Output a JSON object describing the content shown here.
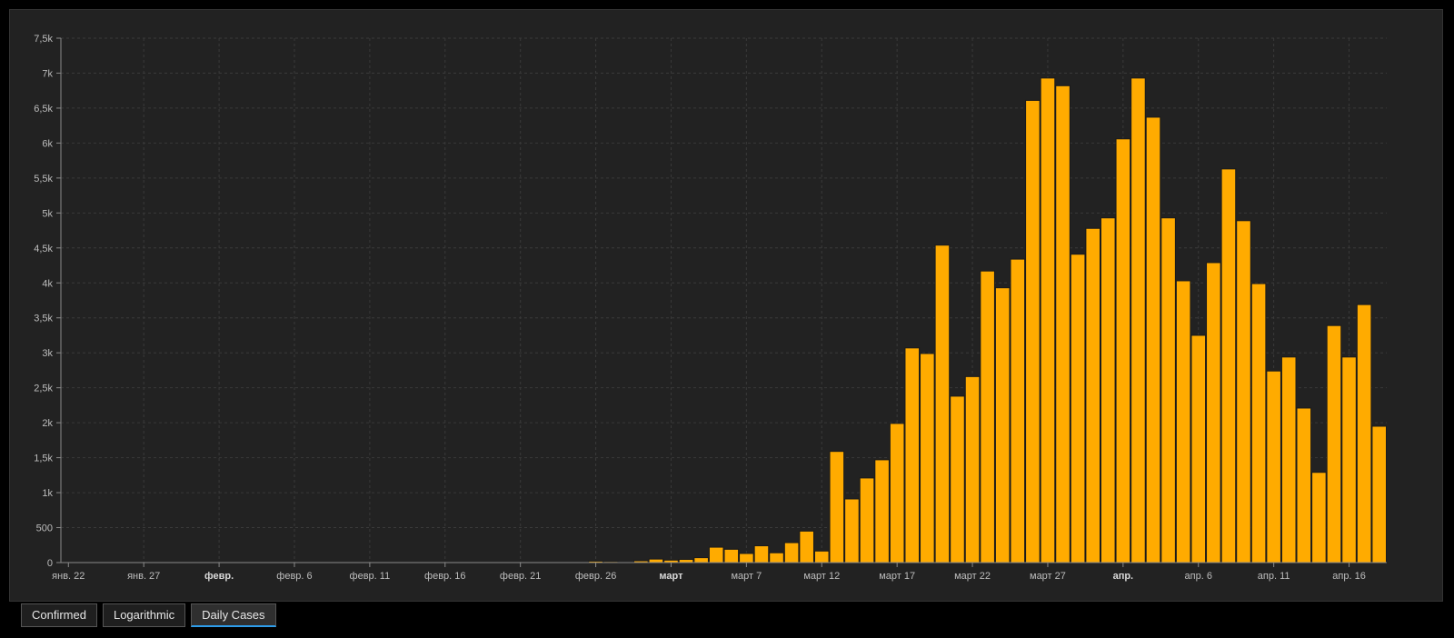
{
  "tabs": [
    {
      "label": "Confirmed",
      "active": false
    },
    {
      "label": "Logarithmic",
      "active": false
    },
    {
      "label": "Daily Cases",
      "active": true
    }
  ],
  "chart_data": {
    "type": "bar",
    "title": "",
    "xlabel": "",
    "ylabel": "",
    "ylim": [
      0,
      7500
    ],
    "grid": true,
    "bar_color": "#ffab00",
    "y_ticks": [
      {
        "value": 0,
        "label": "0"
      },
      {
        "value": 500,
        "label": "500"
      },
      {
        "value": 1000,
        "label": "1k"
      },
      {
        "value": 1500,
        "label": "1,5k"
      },
      {
        "value": 2000,
        "label": "2k"
      },
      {
        "value": 2500,
        "label": "2,5k"
      },
      {
        "value": 3000,
        "label": "3k"
      },
      {
        "value": 3500,
        "label": "3,5k"
      },
      {
        "value": 4000,
        "label": "4k"
      },
      {
        "value": 4500,
        "label": "4,5k"
      },
      {
        "value": 5000,
        "label": "5k"
      },
      {
        "value": 5500,
        "label": "5,5k"
      },
      {
        "value": 6000,
        "label": "6k"
      },
      {
        "value": 6500,
        "label": "6,5k"
      },
      {
        "value": 7000,
        "label": "7k"
      },
      {
        "value": 7500,
        "label": "7,5k"
      }
    ],
    "x_ticks": [
      {
        "index": 0,
        "label": "янв. 22",
        "bold": false
      },
      {
        "index": 5,
        "label": "янв. 27",
        "bold": false
      },
      {
        "index": 10,
        "label": "февр.",
        "bold": true
      },
      {
        "index": 15,
        "label": "февр. 6",
        "bold": false
      },
      {
        "index": 20,
        "label": "февр. 11",
        "bold": false
      },
      {
        "index": 25,
        "label": "февр. 16",
        "bold": false
      },
      {
        "index": 30,
        "label": "февр. 21",
        "bold": false
      },
      {
        "index": 35,
        "label": "февр. 26",
        "bold": false
      },
      {
        "index": 40,
        "label": "март",
        "bold": true
      },
      {
        "index": 45,
        "label": "март 7",
        "bold": false
      },
      {
        "index": 50,
        "label": "март 12",
        "bold": false
      },
      {
        "index": 55,
        "label": "март 17",
        "bold": false
      },
      {
        "index": 60,
        "label": "март 22",
        "bold": false
      },
      {
        "index": 65,
        "label": "март 27",
        "bold": false
      },
      {
        "index": 70,
        "label": "апр.",
        "bold": true
      },
      {
        "index": 75,
        "label": "апр. 6",
        "bold": false
      },
      {
        "index": 80,
        "label": "апр. 11",
        "bold": false
      },
      {
        "index": 85,
        "label": "апр. 16",
        "bold": false
      }
    ],
    "values": [
      0,
      0,
      0,
      0,
      0,
      0,
      0,
      0,
      0,
      0,
      0,
      0,
      0,
      0,
      0,
      0,
      0,
      0,
      0,
      0,
      0,
      0,
      0,
      0,
      0,
      0,
      0,
      0,
      0,
      0,
      0,
      0,
      0,
      0,
      0,
      20,
      15,
      5,
      25,
      50,
      35,
      45,
      70,
      220,
      190,
      130,
      240,
      140,
      285,
      450,
      165,
      1590,
      910,
      1210,
      1470,
      1990,
      3070,
      2990,
      4540,
      2380,
      2660,
      4170,
      3930,
      4340,
      6610,
      6930,
      6820,
      4410,
      4780,
      4930,
      6060,
      6930,
      6370,
      4930,
      4030,
      3250,
      4290,
      5630,
      4890,
      3990,
      2740,
      2940,
      2210,
      1290,
      3390,
      2940,
      3690,
      1950
    ]
  }
}
